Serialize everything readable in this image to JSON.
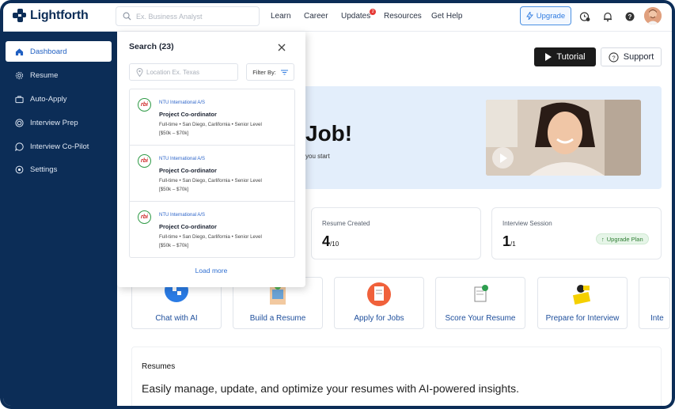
{
  "brand": {
    "name": "Lightforth"
  },
  "header": {
    "search_placeholder": "Ex. Business Analyst",
    "nav": [
      "Learn",
      "Career",
      "Updates",
      "Resources",
      "Get Help"
    ],
    "updates_badge": "2",
    "upgrade_label": "Upgrade"
  },
  "sidebar": {
    "items": [
      {
        "label": "Dashboard",
        "icon": "home-icon"
      },
      {
        "label": "Resume",
        "icon": "gear-outline-icon"
      },
      {
        "label": "Auto-Apply",
        "icon": "briefcase-icon"
      },
      {
        "label": "Interview Prep",
        "icon": "target-icon"
      },
      {
        "label": "Interview Co-Pilot",
        "icon": "chat-icon"
      },
      {
        "label": "Settings",
        "icon": "settings-icon"
      }
    ]
  },
  "search_panel": {
    "title": "Search (23)",
    "location_placeholder": "Location Ex. Texas",
    "filter_label": "Filter By:",
    "jobs": [
      {
        "logo": "rbi",
        "company": "NTU International A/S",
        "title": "Project Co-ordinator",
        "meta": "Full-time • San Diego, Carlifornia • Senior Level",
        "salary": "[$50k – $70k]"
      },
      {
        "logo": "rbi",
        "company": "NTU International A/S",
        "title": "Project Co-ordinator",
        "meta": "Full-time • San Diego, Carlifornia • Senior Level",
        "salary": "[$50k – $70k]"
      },
      {
        "logo": "rbi",
        "company": "NTU International A/S",
        "title": "Project Co-ordinator",
        "meta": "Full-time • San Diego, Carlifornia • Senior Level",
        "salary": "[$50k – $70k]"
      }
    ],
    "load_more": "Load more"
  },
  "main": {
    "tutorial_label": "Tutorial",
    "support_label": "Support",
    "hero": {
      "title_fragment": "Job!",
      "subtitle_fragment": "you start"
    },
    "stats": [
      {
        "label": "Resume Created",
        "value": "4",
        "total": "/10"
      },
      {
        "label": "Interview Session",
        "value": "1",
        "total": "/1",
        "action": "Upgrade Plan"
      }
    ],
    "tiles": [
      "Chat with AI",
      "Build a Resume",
      "Apply for Jobs",
      "Score Your Resume",
      "Prepare for Interview",
      "Inte"
    ],
    "resumes": {
      "title": "Resumes",
      "description": "Easily manage, update, and optimize your resumes with AI-powered insights."
    }
  },
  "colors": {
    "sidebar": "#0c2d57",
    "accent": "#2f7be0",
    "hero_bg": "#e3eefb",
    "success": "#2e7d32"
  }
}
